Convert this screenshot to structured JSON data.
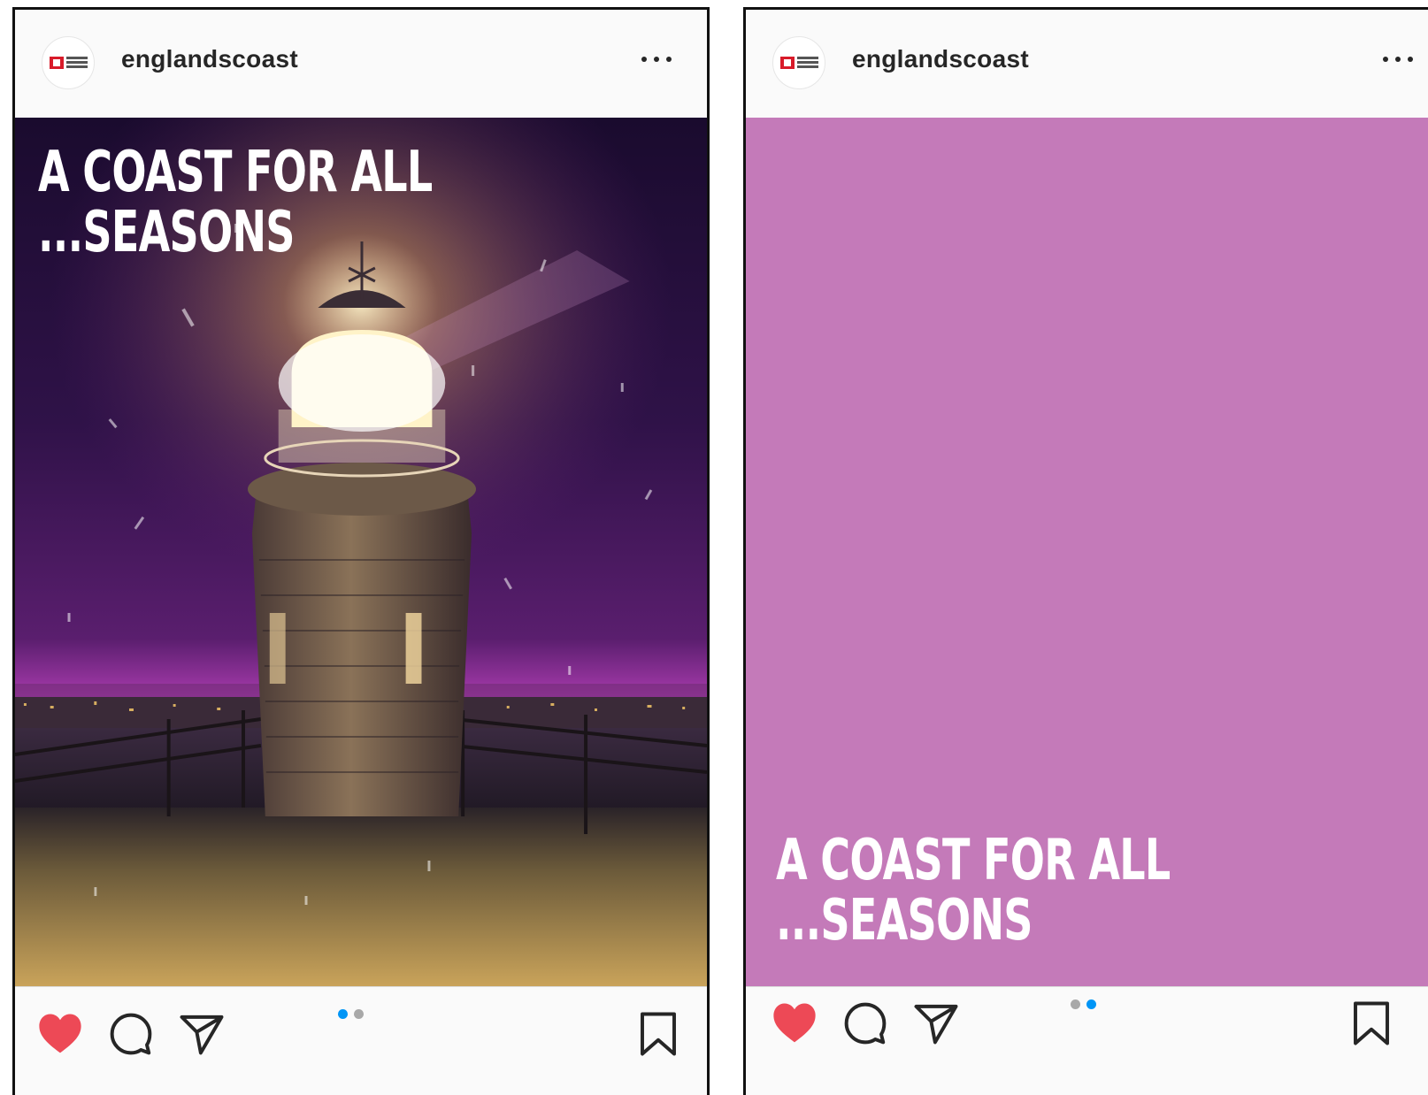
{
  "posts": [
    {
      "username": "englandscoast",
      "slide_title_line1": "A COAST FOR ALL",
      "slide_title_line2": "...SEASONS",
      "carousel_active_index": 1,
      "carousel_count": 2,
      "liked": true
    },
    {
      "username": "englandscoast",
      "slide_title_line1": "A COAST FOR ALL",
      "slide_title_line2": "...SEASONS",
      "slide_background": "#c47ab9",
      "carousel_active_index": 2,
      "carousel_count": 2,
      "liked": true
    }
  ],
  "colors": {
    "like": "#ed4956",
    "active_dot": "#0095f6",
    "inactive_dot": "#a8a8a8",
    "night_sky": "#2a0f3e",
    "lamp_glow": "#fff3c8"
  },
  "icons": {
    "more": "more-options-icon",
    "like": "heart-icon",
    "comment": "comment-icon",
    "share": "send-icon",
    "save": "bookmark-icon"
  }
}
